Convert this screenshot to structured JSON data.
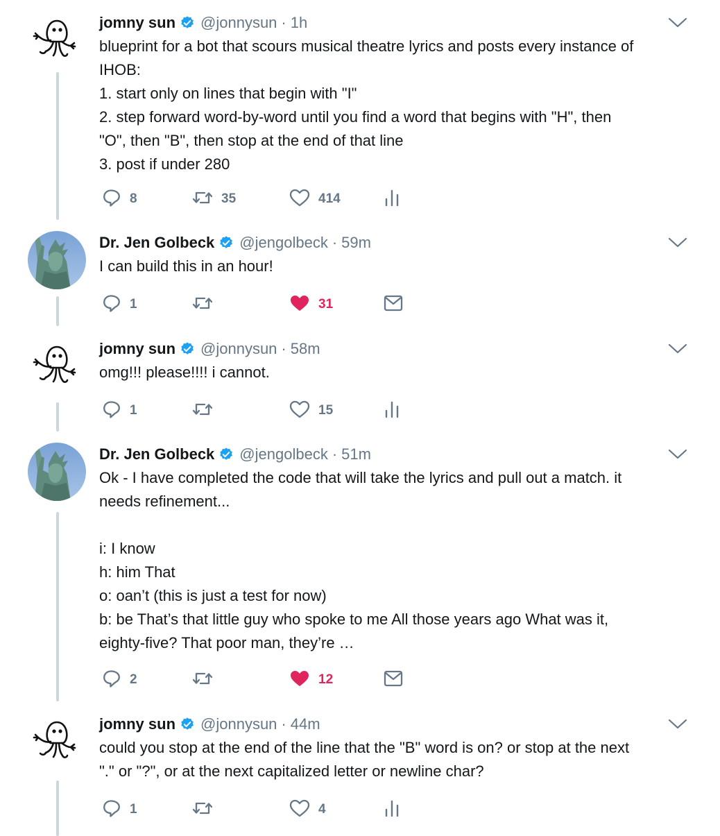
{
  "colors": {
    "verified": "#1da1f2",
    "like_active": "#e0245e",
    "muted_text": "#657786",
    "thread_line": "#ccd6dd"
  },
  "tweets": [
    {
      "name": "jomny sun",
      "handle": "@jonnysun",
      "dot": "·",
      "time": "1h",
      "avatar_icon": "alien-doodle-avatar",
      "lines": [
        "blueprint for a bot that scours musical theatre lyrics and posts every instance of",
        "IHOB:",
        "1. start only on lines that begin with \"I\"",
        "2. step forward word-by-word until you find a word that begins with \"H\", then",
        "\"O\", then \"B\", then stop at the end of that line",
        "3. post if under 280"
      ],
      "reply_count": "8",
      "retweet_count": "35",
      "like_count": "414",
      "liked": false,
      "extra_icon": "analytics-icon"
    },
    {
      "name": "Dr. Jen Golbeck",
      "handle": "@jengolbeck",
      "dot": "·",
      "time": "59m",
      "avatar_icon": "statue-of-liberty-avatar",
      "lines": [
        "I can build this in an hour!"
      ],
      "reply_count": "1",
      "retweet_count": "",
      "like_count": "31",
      "liked": true,
      "extra_icon": "direct-message-icon"
    },
    {
      "name": "jomny sun",
      "handle": "@jonnysun",
      "dot": "·",
      "time": "58m",
      "avatar_icon": "alien-doodle-avatar",
      "lines": [
        "omg!!! please!!!! i cannot."
      ],
      "reply_count": "1",
      "retweet_count": "",
      "like_count": "15",
      "liked": false,
      "extra_icon": "analytics-icon"
    },
    {
      "name": "Dr. Jen Golbeck",
      "handle": "@jengolbeck",
      "dot": "·",
      "time": "51m",
      "avatar_icon": "statue-of-liberty-avatar",
      "lines": [
        "Ok - I have completed the code that will take the lyrics and pull out a match. it",
        "needs refinement...",
        "",
        "i: I know",
        "h: him That",
        "o: oan’t (this is just a test for now)",
        "b: be That’s that little guy who spoke to me All those years ago What was it,",
        "eighty-five? That poor man, they’re …"
      ],
      "reply_count": "2",
      "retweet_count": "",
      "like_count": "12",
      "liked": true,
      "extra_icon": "direct-message-icon"
    },
    {
      "name": "jomny sun",
      "handle": "@jonnysun",
      "dot": "·",
      "time": "44m",
      "avatar_icon": "alien-doodle-avatar",
      "lines": [
        "could you stop at the end of the line that the \"B\" word is on? or stop at the next",
        "\".\" or \"?\", or at the next capitalized letter or newline char?"
      ],
      "reply_count": "1",
      "retweet_count": "",
      "like_count": "4",
      "liked": false,
      "extra_icon": "analytics-icon"
    }
  ]
}
